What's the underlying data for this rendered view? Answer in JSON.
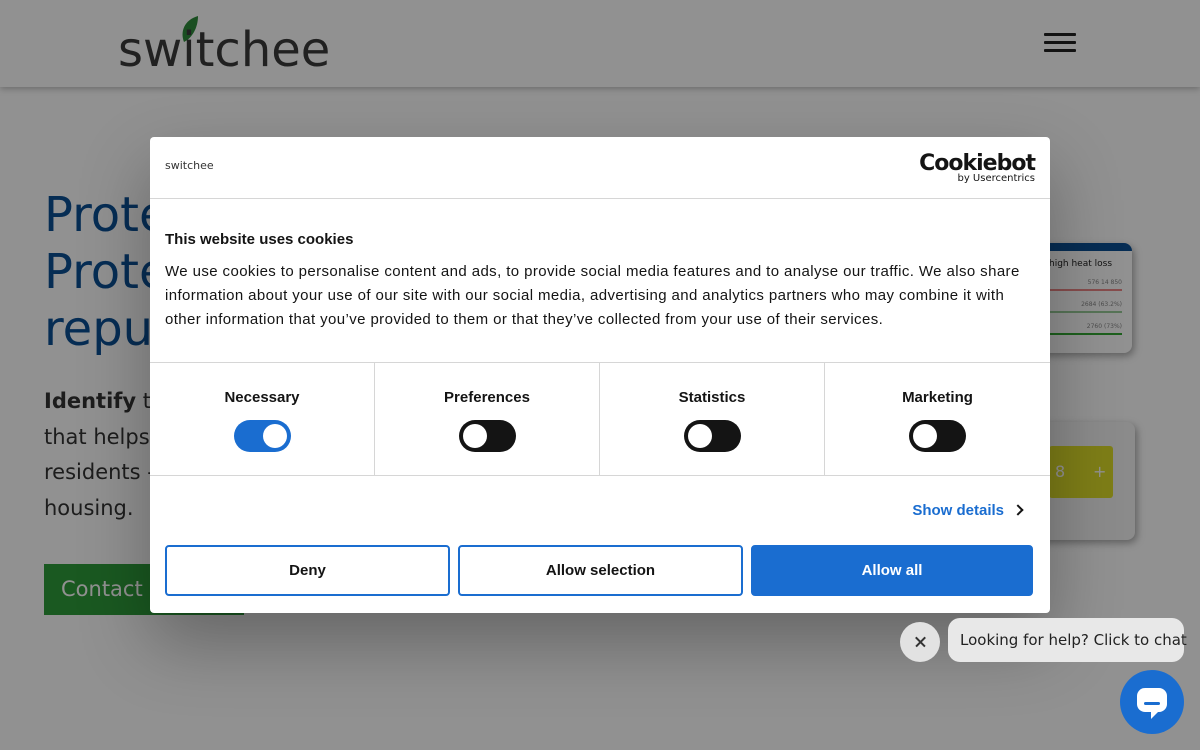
{
  "header": {
    "logo_text": "switchee",
    "menu_icon": "hamburger-menu-icon"
  },
  "hero": {
    "title_lines": [
      "Prote",
      "Prote",
      "repu"
    ],
    "body_bold": "Identify",
    "body_lines": [
      " th",
      "that helps s",
      "residents -",
      "housing."
    ],
    "cta_label": "Contact u"
  },
  "background_cards": {
    "card1_title": "high heat loss",
    "card1_rows": [
      "576 14 850",
      "2684 (63.2%)",
      "2760 (73%)"
    ],
    "card2_display": [
      "8",
      "+"
    ]
  },
  "cookie_dialog": {
    "logo_text": "switchee",
    "brand": "Cookiebot",
    "brand_sub": "by Usercentrics",
    "title": "This website uses cookies",
    "description": "We use cookies to personalise content and ads, to provide social media features and to analyse our traffic. We also share information about your use of our site with our social media, advertising and analytics partners who may combine it with other information that you’ve provided to them or that they’ve collected from your use of their services.",
    "categories": [
      {
        "label": "Necessary",
        "checked": true
      },
      {
        "label": "Preferences",
        "checked": false
      },
      {
        "label": "Statistics",
        "checked": false
      },
      {
        "label": "Marketing",
        "checked": false
      }
    ],
    "show_details": "Show details",
    "buttons": {
      "deny": "Deny",
      "allow_selection": "Allow selection",
      "allow_all": "Allow all"
    }
  },
  "chat": {
    "prompt": "Looking for help? Click to chat",
    "close_icon": "close-icon",
    "launcher_icon": "chat-bubble-icon"
  },
  "colors": {
    "accent_blue": "#1a6dd0",
    "hero_blue": "#0c4f95",
    "cta_green": "#2f9d3a"
  }
}
